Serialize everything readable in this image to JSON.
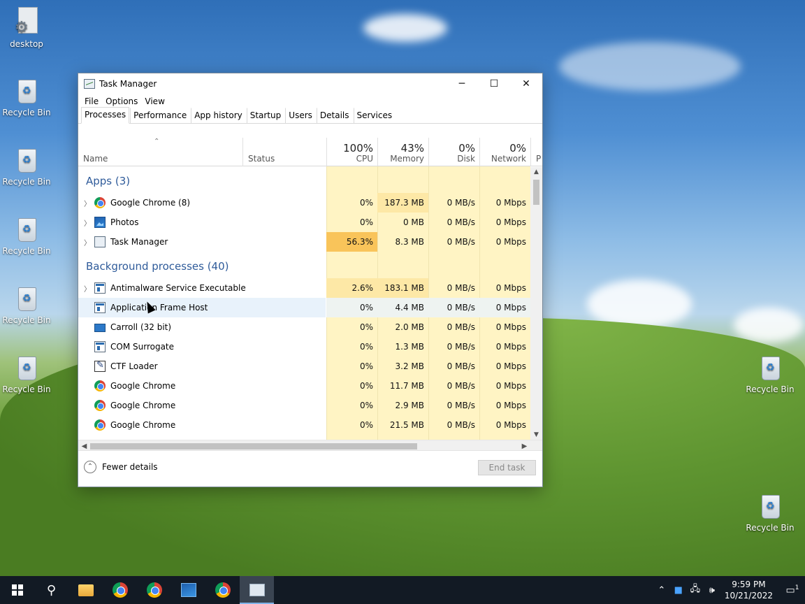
{
  "desktop": {
    "icons": [
      {
        "label": "desktop"
      },
      {
        "label": "Recycle Bin"
      },
      {
        "label": "Recycle Bin"
      },
      {
        "label": "Recycle Bin"
      },
      {
        "label": "Recycle Bin"
      },
      {
        "label": "Recycle Bin"
      },
      {
        "label": "Recycle Bin"
      },
      {
        "label": "Recycle Bin"
      }
    ]
  },
  "window": {
    "title": "Task Manager",
    "minimize": "─",
    "maximize": "☐",
    "close": "✕"
  },
  "menu": [
    "File",
    "Options",
    "View"
  ],
  "tabs": [
    "Processes",
    "Performance",
    "App history",
    "Startup",
    "Users",
    "Details",
    "Services"
  ],
  "columns": {
    "name": "Name",
    "status": "Status",
    "cpu": {
      "pct": "100%",
      "label": "CPU"
    },
    "memory": {
      "pct": "43%",
      "label": "Memory"
    },
    "disk": {
      "pct": "0%",
      "label": "Disk"
    },
    "network": {
      "pct": "0%",
      "label": "Network"
    },
    "power": "P"
  },
  "groups": {
    "apps": "Apps (3)",
    "background": "Background processes (40)"
  },
  "rows": [
    {
      "name": "Google Chrome (8)",
      "cpu": "0%",
      "memory": "187.3 MB",
      "disk": "0 MB/s",
      "network": "0 Mbps",
      "icon": "chrome-icon",
      "expand": "〉"
    },
    {
      "name": "Photos",
      "cpu": "0%",
      "memory": "0 MB",
      "disk": "0 MB/s",
      "network": "0 Mbps",
      "icon": "photos-icon",
      "expand": "〉"
    },
    {
      "name": "Task Manager",
      "cpu": "56.3%",
      "memory": "8.3 MB",
      "disk": "0 MB/s",
      "network": "0 Mbps",
      "icon": "task-manager-icon",
      "expand": "〉"
    },
    {
      "name": "Antimalware Service Executable",
      "cpu": "2.6%",
      "memory": "183.1 MB",
      "disk": "0 MB/s",
      "network": "0 Mbps",
      "icon": "window-process-icon",
      "expand": "〉"
    },
    {
      "name": "Application Frame Host",
      "cpu": "0%",
      "memory": "4.4 MB",
      "disk": "0 MB/s",
      "network": "0 Mbps",
      "icon": "window-process-icon"
    },
    {
      "name": "Carroll (32 bit)",
      "cpu": "0%",
      "memory": "2.0 MB",
      "disk": "0 MB/s",
      "network": "0 Mbps",
      "icon": "monitor-icon"
    },
    {
      "name": "COM Surrogate",
      "cpu": "0%",
      "memory": "1.3 MB",
      "disk": "0 MB/s",
      "network": "0 Mbps",
      "icon": "window-process-icon"
    },
    {
      "name": "CTF Loader",
      "cpu": "0%",
      "memory": "3.2 MB",
      "disk": "0 MB/s",
      "network": "0 Mbps",
      "icon": "ctf-loader-icon"
    },
    {
      "name": "Google Chrome",
      "cpu": "0%",
      "memory": "11.7 MB",
      "disk": "0 MB/s",
      "network": "0 Mbps",
      "icon": "chrome-icon"
    },
    {
      "name": "Google Chrome",
      "cpu": "0%",
      "memory": "2.9 MB",
      "disk": "0 MB/s",
      "network": "0 Mbps",
      "icon": "chrome-icon"
    },
    {
      "name": "Google Chrome",
      "cpu": "0%",
      "memory": "21.5 MB",
      "disk": "0 MB/s",
      "network": "0 Mbps",
      "icon": "chrome-icon"
    }
  ],
  "footer": {
    "fewer_details": "Fewer details",
    "end_task": "End task"
  },
  "taskbar": {
    "time": "9:59 PM",
    "date": "10/21/2022",
    "notification_count": "1"
  },
  "colors": {
    "accent": "#2f5b9a",
    "cpu_hot": "#f9c45a",
    "heat_light": "#fff4c4",
    "taskbar": "#121a24"
  }
}
